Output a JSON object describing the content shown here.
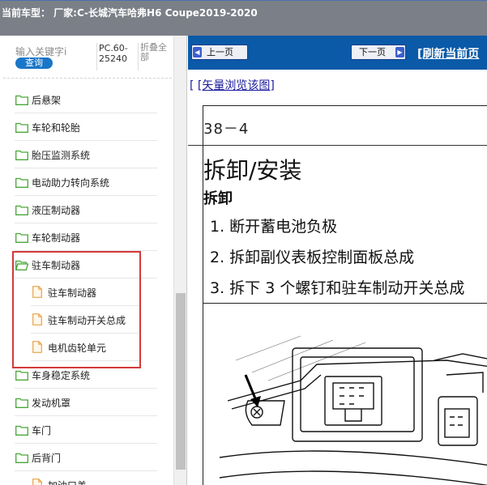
{
  "window": {
    "title": "当前车型：  厂家:C-长城汽车哈弗H6 Coupe2019-2020"
  },
  "sidebar": {
    "search": {
      "placeholder": "输入关键字i",
      "button_label": "查询"
    },
    "pc_code": "PC.60-25240",
    "collapse_all_label": "折叠全部",
    "tree": [
      {
        "type": "folder",
        "label": "后悬架"
      },
      {
        "type": "folder",
        "label": "车轮和轮胎"
      },
      {
        "type": "folder",
        "label": "胎压监测系统"
      },
      {
        "type": "folder",
        "label": "电动助力转向系统"
      },
      {
        "type": "folder",
        "label": "液压制动器"
      },
      {
        "type": "folder",
        "label": "车轮制动器"
      },
      {
        "type": "folder-open",
        "label": "驻车制动器"
      },
      {
        "type": "doc",
        "label": "驻车制动器"
      },
      {
        "type": "doc",
        "label": "驻车制动开关总成"
      },
      {
        "type": "doc",
        "label": "电机齿轮单元"
      },
      {
        "type": "folder",
        "label": "车身稳定系统"
      },
      {
        "type": "folder",
        "label": "发动机罩"
      },
      {
        "type": "folder",
        "label": "车门"
      },
      {
        "type": "folder",
        "label": "后背门"
      },
      {
        "type": "doc",
        "label": "加油口盖"
      }
    ],
    "highlight_color": "#d43a3a"
  },
  "toolbar": {
    "prev_label": "上一页",
    "next_label": "下一页",
    "refresh_label": "[刷新当前页"
  },
  "content": {
    "vector_link_prefix": "[",
    "vector_link_label": "[矢量浏览该图]",
    "page_number": "38－4",
    "title": "拆卸/安装",
    "section": "拆卸",
    "steps": [
      "1.  断开蓄电池负极",
      "2.  拆卸副仪表板控制面板总成",
      "3.  拆下 3 个螺钉和驻车制动开关总成"
    ]
  },
  "colors": {
    "topbar": "#7b7f87",
    "navbar": "#0b5aa8",
    "search_button": "#1976c8",
    "folder_icon": "#4aa63a",
    "doc_icon": "#e8a24a"
  }
}
